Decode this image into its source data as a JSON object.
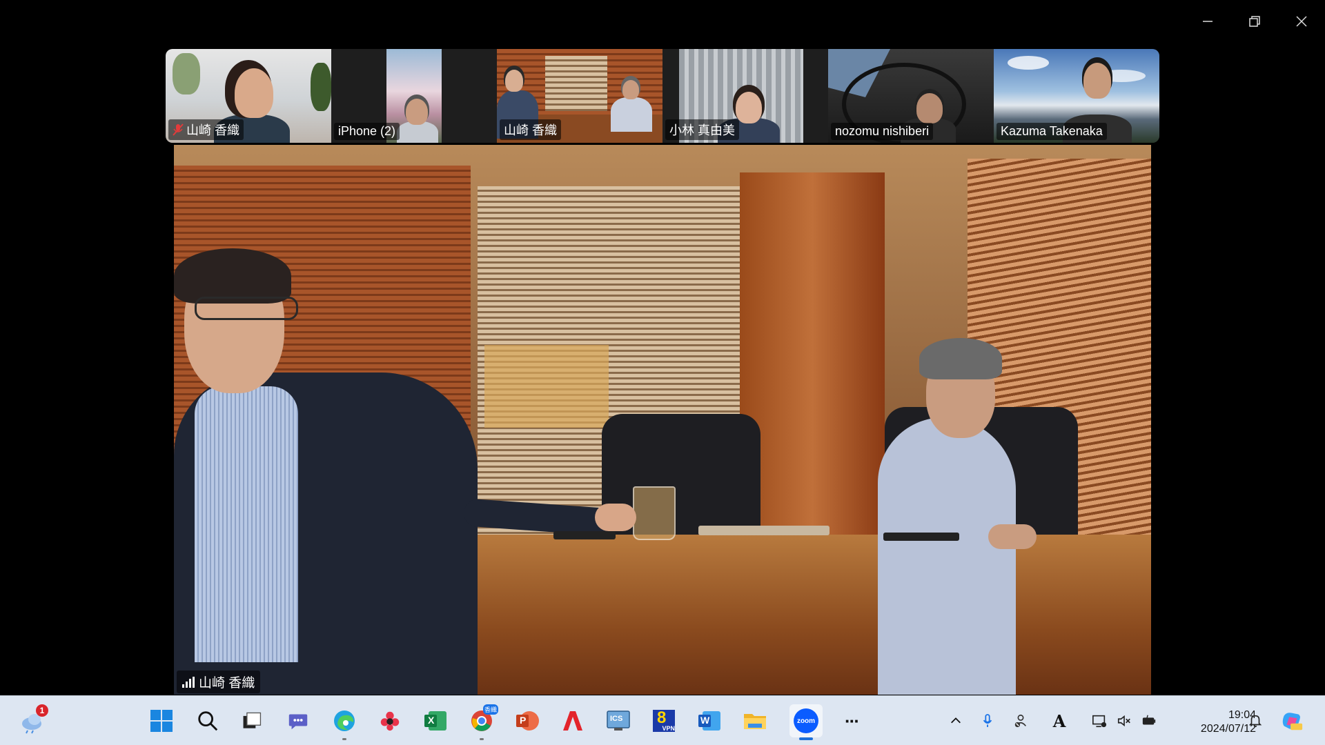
{
  "window": {
    "controls": [
      "minimize",
      "restore",
      "close"
    ]
  },
  "participants": [
    {
      "name": "山崎 香織",
      "muted": true,
      "active": false
    },
    {
      "name": "iPhone (2)",
      "muted": false,
      "active": false
    },
    {
      "name": "山崎 香織",
      "muted": false,
      "active": true
    },
    {
      "name": "小林 真由美",
      "muted": false,
      "active": false
    },
    {
      "name": "nozomu nishiberi",
      "muted": false,
      "active": false
    },
    {
      "name": "Kazuma Takenaka",
      "muted": false,
      "active": false
    }
  ],
  "main_video": {
    "speaker_name": "山崎 香織"
  },
  "taskbar": {
    "weather_badge": "1",
    "apps": [
      "windows-start",
      "search",
      "task-view",
      "teams",
      "edge",
      "photos",
      "excel",
      "chrome",
      "powerpoint",
      "acrobat",
      "ics",
      "vpn",
      "word",
      "file-explorer",
      "zoom",
      "more"
    ],
    "zoom_label": "zoom",
    "word_letter": "W",
    "excel_letter": "X",
    "ppt_letter": "P",
    "vpn_number": "8",
    "vpn_label": "VPN",
    "ics_label": "ICS",
    "chrome_badge": "香織",
    "more_label": "···",
    "tray": {
      "time": "19:04",
      "date": "2024/07/12",
      "ime_label": "A"
    }
  },
  "colors": {
    "active_tile": "#22c55e",
    "taskbar_bg": "#dde6f2",
    "zoom_blue": "#0b5cff"
  }
}
